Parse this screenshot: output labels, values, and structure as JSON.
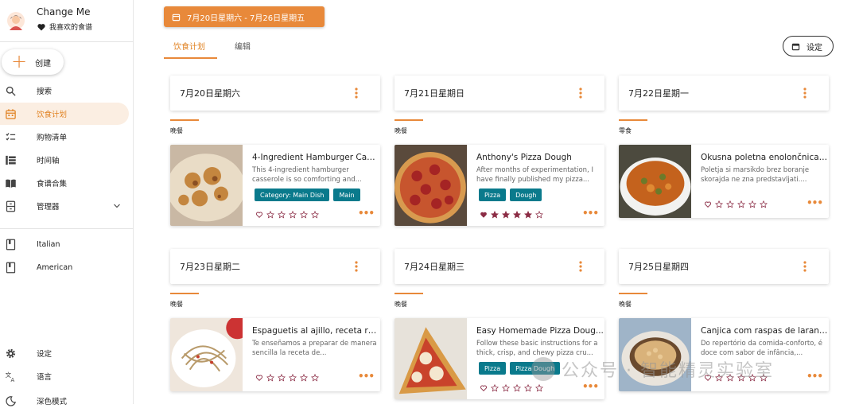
{
  "sidebar": {
    "user": {
      "name": "Change Me",
      "favorites_label": "我喜欢的食谱"
    },
    "create_label": "创建",
    "nav": [
      {
        "label": "搜索",
        "icon": "search-icon"
      },
      {
        "label": "饮食计划",
        "icon": "calendar-icon",
        "active": true
      },
      {
        "label": "购物清单",
        "icon": "checklist-icon"
      },
      {
        "label": "时间轴",
        "icon": "timeline-icon"
      },
      {
        "label": "食谱合集",
        "icon": "book-icon"
      },
      {
        "label": "管理器",
        "icon": "organizer-icon"
      }
    ],
    "cookbooks": [
      {
        "label": "Italian",
        "icon": "cookbook-icon"
      },
      {
        "label": "American",
        "icon": "cookbook-icon"
      }
    ],
    "bottom": [
      {
        "label": "设定",
        "icon": "gear-icon"
      },
      {
        "label": "语言",
        "icon": "translate-icon"
      },
      {
        "label": "深色模式",
        "icon": "dark-mode-icon"
      }
    ]
  },
  "header": {
    "date_range": "7月20日星期六 - 7月26日星期五",
    "tabs": [
      {
        "label": "饮食计划",
        "active": true
      },
      {
        "label": "编辑"
      }
    ],
    "settings_label": "设定"
  },
  "days": [
    {
      "title": "7月20日星期六",
      "meal": "晚餐",
      "recipe": {
        "title": "4-Ingredient Hamburger Cass...",
        "description": "This 4-ingredient hamburger casserole is so comforting and...",
        "tags": [
          "Category: Main Dish",
          "Main"
        ],
        "rating": 0
      }
    },
    {
      "title": "7月21日星期日",
      "meal": "晚餐",
      "recipe": {
        "title": "Anthony's Pizza Dough",
        "description": "After months of experimentation, I have finally published my pizza...",
        "tags": [
          "Pizza",
          "Dough"
        ],
        "rating": 4
      }
    },
    {
      "title": "7月22日星期一",
      "meal": "零食",
      "recipe": {
        "title": "Okusna poletna enolončnica, ...",
        "description": "Poletja si marsikdo brez boranje skorajda ne zna predstavljati....",
        "tags": [],
        "rating": 0
      }
    },
    {
      "title": "7月23日星期二",
      "meal": "晚餐",
      "recipe": {
        "title": "Espaguetis al ajillo, receta ráp...",
        "description": "Te enseñamos a preparar de manera sencilla la receta de...",
        "tags": [],
        "rating": 0
      }
    },
    {
      "title": "7月24日星期三",
      "meal": "晚餐",
      "recipe": {
        "title": "Easy Homemade Pizza Doug...",
        "description": "Follow these basic instructions for a thick, crisp, and chewy pizza cru...",
        "tags": [
          "Pizza",
          "Pizza Dough"
        ],
        "rating": 0
      }
    },
    {
      "title": "7月25日星期四",
      "meal": "晚餐",
      "recipe": {
        "title": "Canjica com raspas de laranj...",
        "description": "Do repertório da comida-conforto, é doce com sabor de infância,...",
        "tags": [],
        "rating": 0
      }
    }
  ],
  "watermark": "公众号 · 智能精灵实验室",
  "colors": {
    "accent": "#e8893a",
    "tag": "#0a7a8c",
    "heart": "#8b2c45",
    "active_bg": "#fbeee2"
  }
}
